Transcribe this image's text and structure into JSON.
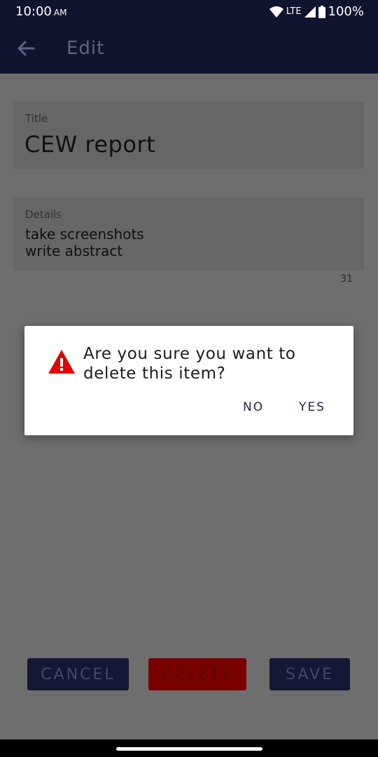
{
  "status_bar": {
    "time": "10:00",
    "ampm": "AM",
    "network": "LTE",
    "battery": "100%"
  },
  "app_bar": {
    "title": "Edit"
  },
  "form": {
    "title_label": "Title",
    "title_value": "CEW report",
    "details_label": "Details",
    "details_lines": [
      "take screenshots",
      "write abstract"
    ],
    "char_count": "31"
  },
  "dialog": {
    "message": "Are you sure you want to delete this item?",
    "no_label": "NO",
    "yes_label": "YES",
    "icon": "warning-icon"
  },
  "actions": {
    "cancel_label": "CANCEL",
    "delete_label": "DELETE",
    "save_label": "SAVE"
  },
  "colors": {
    "appbar": "#11142e",
    "warning": "#e60000",
    "delete": "#780000"
  }
}
